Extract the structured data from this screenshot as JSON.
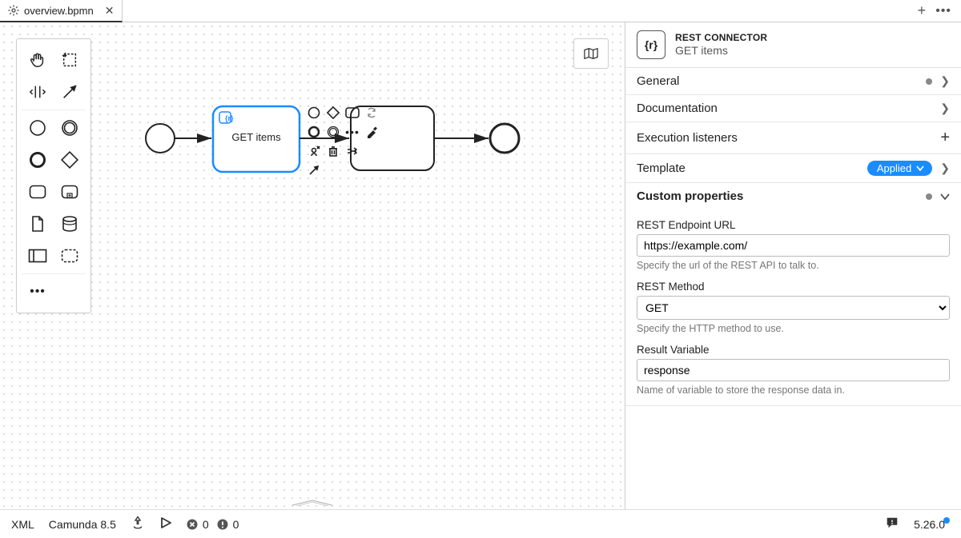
{
  "tab": {
    "title": "overview.bpmn"
  },
  "task": {
    "label": "GET items"
  },
  "properties": {
    "kicker": "REST CONNECTOR",
    "name": "GET items",
    "sections": {
      "general": "General",
      "documentation": "Documentation",
      "execution_listeners": "Execution listeners",
      "template": "Template",
      "template_badge": "Applied",
      "custom_properties": "Custom properties"
    },
    "fields": {
      "endpoint_label": "REST Endpoint URL",
      "endpoint_value": "https://example.com/",
      "endpoint_help": "Specify the url of the REST API to talk to.",
      "method_label": "REST Method",
      "method_value": "GET",
      "method_help": "Specify the HTTP method to use.",
      "result_label": "Result Variable",
      "result_value": "response",
      "result_help": "Name of variable to store the response data in."
    }
  },
  "status": {
    "xml": "XML",
    "engine": "Camunda 8.5",
    "errors": "0",
    "warnings": "0",
    "version": "5.26.0"
  }
}
